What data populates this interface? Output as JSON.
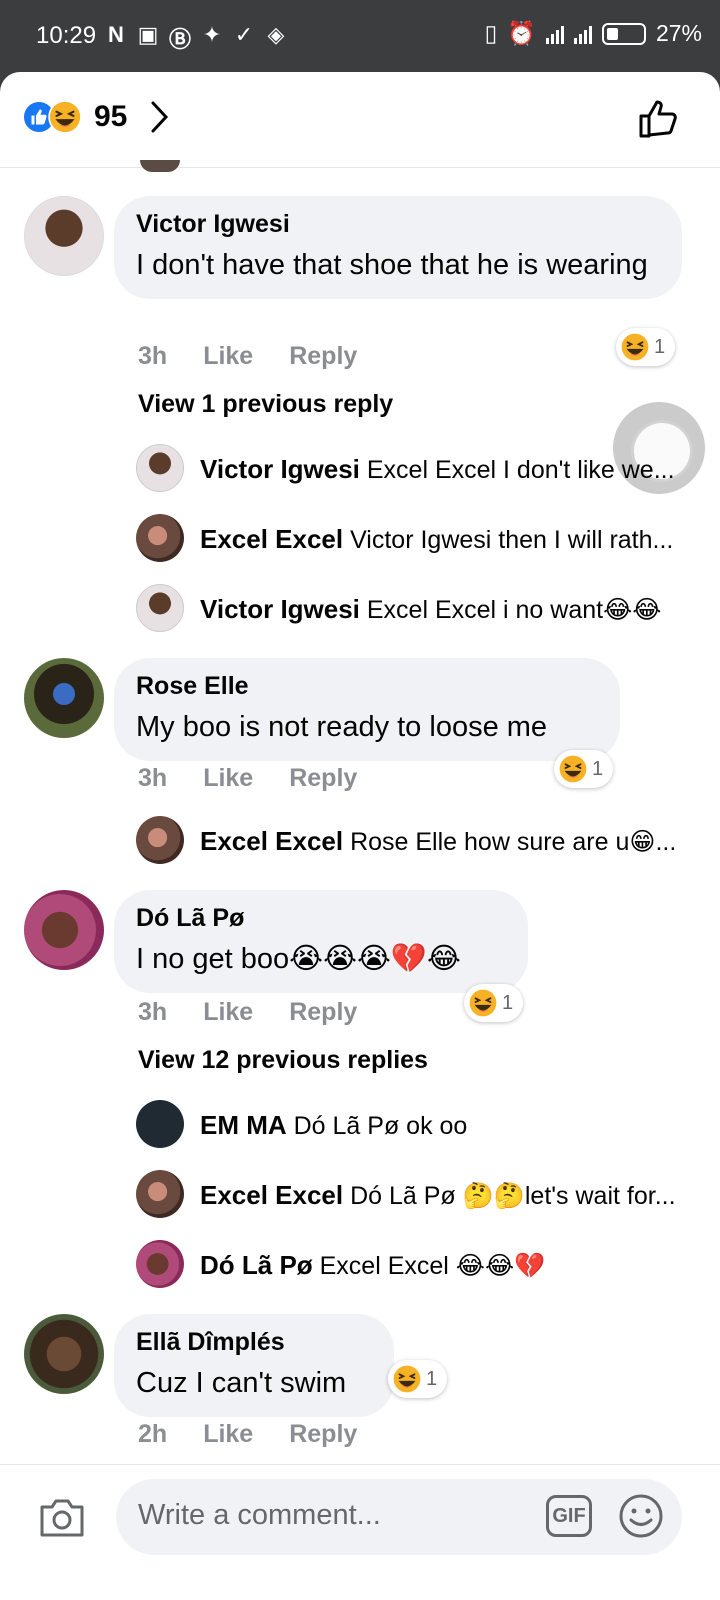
{
  "status_bar": {
    "time": "10:29",
    "battery": "27%"
  },
  "header": {
    "reaction_count": "95"
  },
  "comments": [
    {
      "author": "Victor Igwesi",
      "text": "I don't have that shoe that he is wearing",
      "time": "3h",
      "like": "Like",
      "reply": "Reply",
      "reaction_count": "1",
      "view_previous": "View 1 previous reply",
      "replies": [
        {
          "author": "Victor Igwesi",
          "text": "Excel Excel I don't like we..."
        },
        {
          "author": "Excel Excel",
          "text": "Victor Igwesi then I will rath..."
        },
        {
          "author": "Victor Igwesi",
          "text": "Excel Excel i no want😂😂"
        }
      ]
    },
    {
      "author": "Rose Elle",
      "text": "My boo is not ready to loose me",
      "time": "3h",
      "like": "Like",
      "reply": "Reply",
      "reaction_count": "1",
      "replies": [
        {
          "author": "Excel Excel",
          "text": "Rose Elle how sure are u😁..."
        }
      ]
    },
    {
      "author": "Dó Lã Pø",
      "text": "I no get boo😭😭😭💔😂",
      "time": "3h",
      "like": "Like",
      "reply": "Reply",
      "reaction_count": "1",
      "view_previous": "View 12 previous replies",
      "replies": [
        {
          "author": "EM MA",
          "text": "Dó Lã Pø ok oo"
        },
        {
          "author": "Excel Excel",
          "text": "Dó Lã Pø 🤔🤔let's wait for..."
        },
        {
          "author": "Dó Lã Pø",
          "text": "Excel Excel 😂😂💔"
        }
      ]
    },
    {
      "author": "Ellã Dîmplés",
      "text": "Cuz I can't swim",
      "time": "2h",
      "like": "Like",
      "reply": "Reply",
      "reaction_count": "1"
    }
  ],
  "composer": {
    "placeholder": "Write a comment...",
    "gif_label": "GIF"
  },
  "icons": [
    "like-icon",
    "haha-icon",
    "chevron-right-icon",
    "thumbs-up-icon",
    "camera-icon",
    "gif-icon",
    "smiley-icon"
  ],
  "colors": {
    "facebook_blue": "#1877f2",
    "bubble": "#f0f2f5",
    "meta_gray": "#8a8d91",
    "status_bar": "#3c3d3f"
  }
}
